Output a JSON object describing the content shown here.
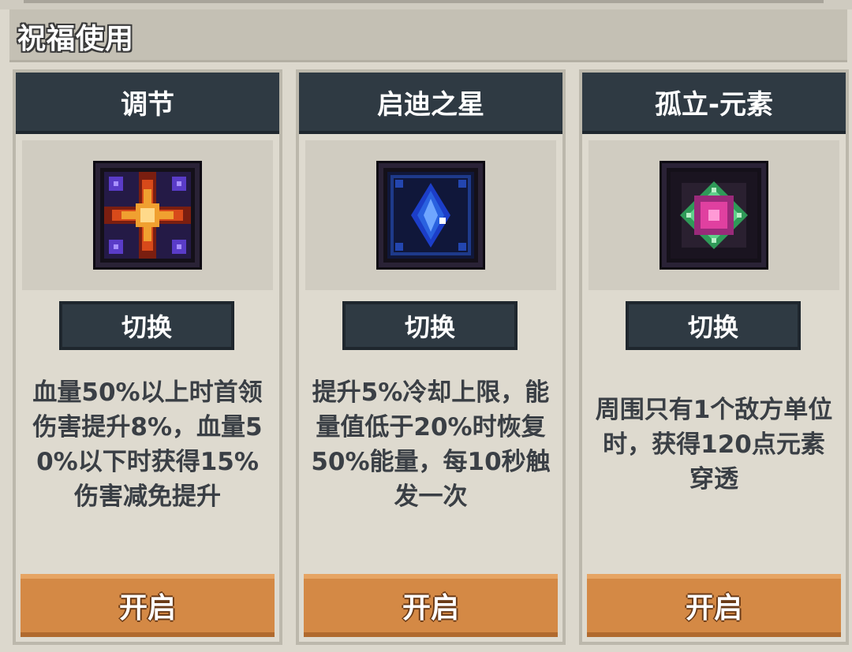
{
  "page": {
    "title": "祝福使用"
  },
  "cards": [
    {
      "name": "调节",
      "icon": "golden-star-icon",
      "switch_label": "切换",
      "description": "血量50%以上时首领伤害提升8%，血量50%以下时获得15%伤害减免提升",
      "open_label": "开启",
      "accent": "#f0a030"
    },
    {
      "name": "启迪之星",
      "icon": "blue-crystal-icon",
      "switch_label": "切换",
      "description": "提升5%冷却上限，能量值低于20%时恢复50%能量，每10秒触发一次",
      "open_label": "开启",
      "accent": "#2a62e0"
    },
    {
      "name": "孤立-元素",
      "icon": "green-pink-orb-icon",
      "switch_label": "切换",
      "description": "周围只有1个敌方单位时，获得120点元素穿透",
      "open_label": "开启",
      "accent": "#e040a0"
    }
  ],
  "colors": {
    "header_dark": "#2f3a43",
    "button_orange": "#d48945",
    "panel_bg": "#dedacf"
  }
}
